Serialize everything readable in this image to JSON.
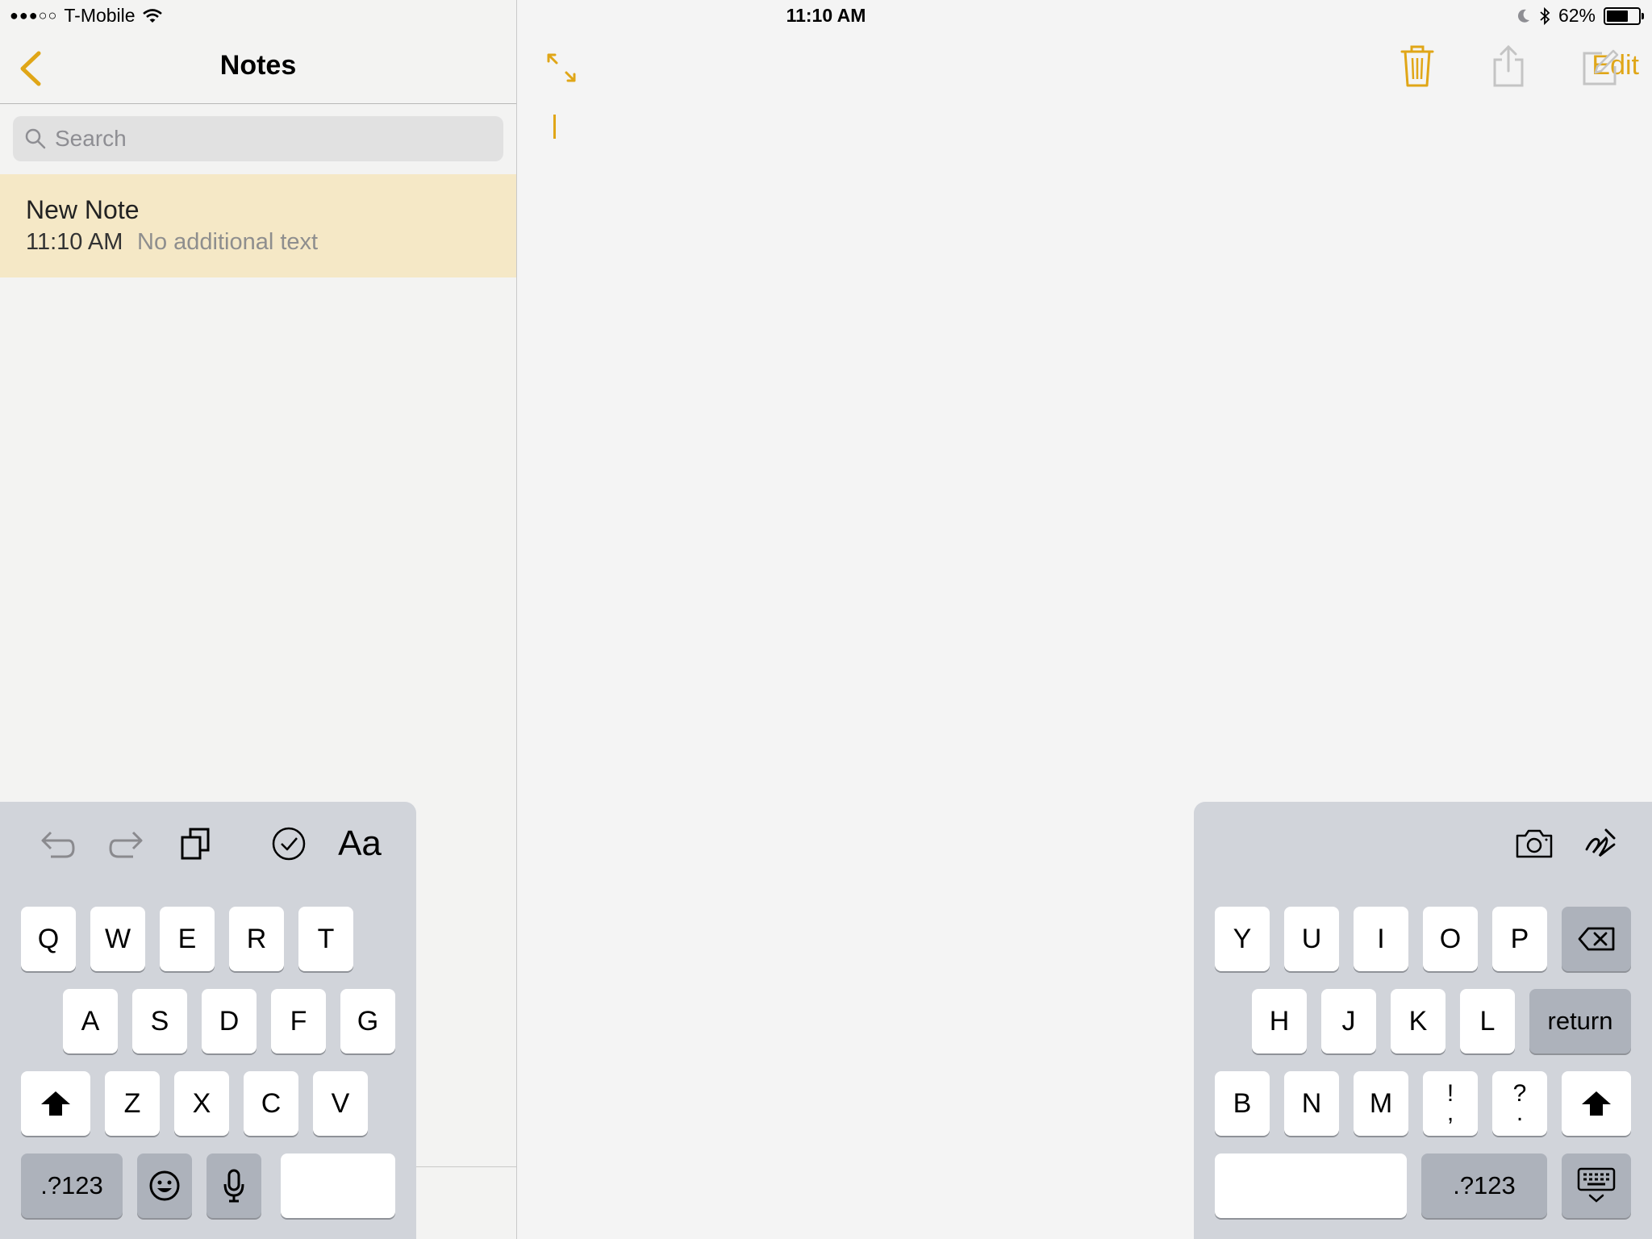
{
  "status_bar": {
    "carrier": "T-Mobile",
    "time": "11:10 AM",
    "battery": "62%",
    "battery_level": 0.62
  },
  "sidebar": {
    "title": "Notes",
    "edit_label": "Edit",
    "search_placeholder": "Search",
    "notes": [
      {
        "title": "New Note",
        "time": "11:10 AM",
        "preview": "No additional text"
      }
    ]
  },
  "colors": {
    "accent": "#e0a617",
    "selected_row": "#f5e8c6",
    "keyboard_bg": "#d1d4da"
  },
  "keyboard": {
    "left_rows": [
      [
        "Q",
        "W",
        "E",
        "R",
        "T"
      ],
      [
        "A",
        "S",
        "D",
        "F",
        "G"
      ],
      [
        "Z",
        "X",
        "C",
        "V"
      ]
    ],
    "right_rows": [
      [
        "Y",
        "U",
        "I",
        "O",
        "P"
      ],
      [
        "H",
        "J",
        "K",
        "L"
      ],
      [
        "B",
        "N",
        "M"
      ]
    ],
    "return_label": "return",
    "numbers_label": ".?123",
    "punct_1": [
      "!",
      ","
    ],
    "punct_2": [
      "?",
      "."
    ]
  }
}
